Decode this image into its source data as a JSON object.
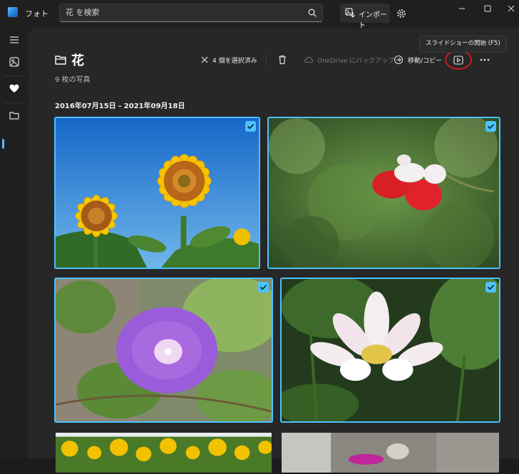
{
  "app": {
    "title": "フォト"
  },
  "search": {
    "placeholder": "花 を検索"
  },
  "header": {
    "import_label": "インポート"
  },
  "album": {
    "title": "花",
    "photo_count": "9 枚の写真",
    "date_range": "2016年07月15日 - 2021年09月18日"
  },
  "toolbar": {
    "deselect_label": "4 個を選択済み",
    "onedrive_label": "OneDrive にバックアップ",
    "move_copy_label": "移動/コピー",
    "slideshow_tooltip": "スライドショーの開始 (F5)"
  },
  "photos": [
    {
      "subject": "sunflowers",
      "selected": true
    },
    {
      "subject": "red-white-salvia",
      "selected": true
    },
    {
      "subject": "morning-glory",
      "selected": true
    },
    {
      "subject": "lotus",
      "selected": true
    },
    {
      "subject": "sunflower-field",
      "selected": false
    },
    {
      "subject": "pink-flower",
      "selected": false
    }
  ],
  "colors": {
    "accent": "#4cc2ff",
    "highlight_ring": "#d11a1a",
    "background": "#272727"
  }
}
